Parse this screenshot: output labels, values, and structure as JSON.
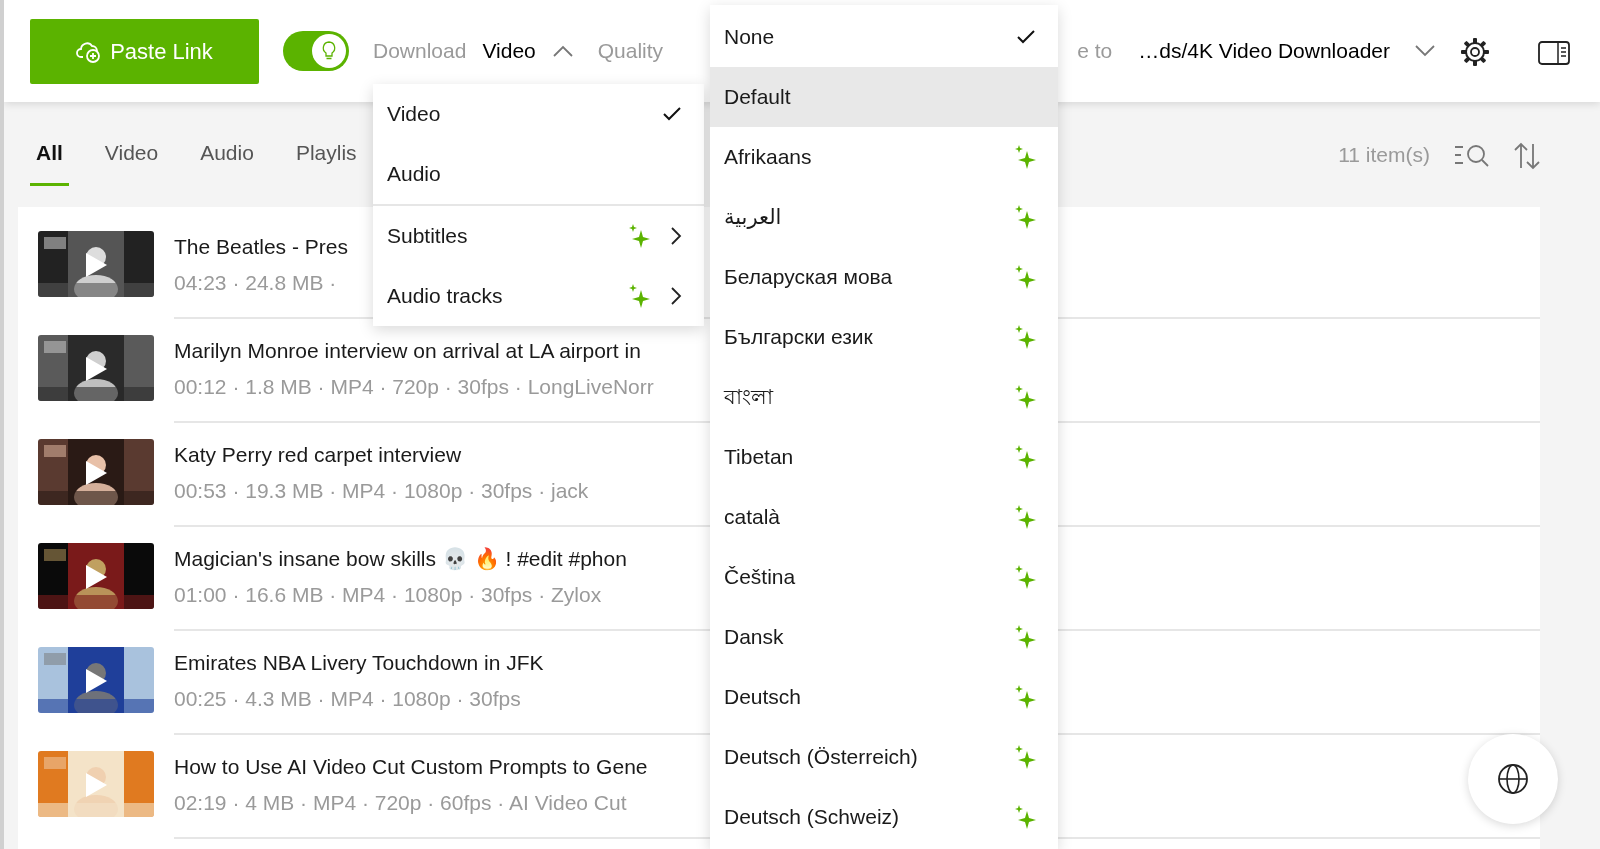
{
  "toolbar": {
    "paste_button": "Paste Link",
    "smart_mode": {
      "on": true
    },
    "download_label": "Download",
    "download_value": "Video",
    "download_open": true,
    "quality_label": "Quality",
    "save_label": "e to",
    "save_path": "…ds/4K Video Downloader"
  },
  "tabs": [
    {
      "label": "All",
      "selected": true
    },
    {
      "label": "Video",
      "selected": false
    },
    {
      "label": "Audio",
      "selected": false
    },
    {
      "label": "Playlis",
      "selected": false
    }
  ],
  "item_count": "11 item(s)",
  "items": [
    {
      "title": "The Beatles - Pres",
      "meta": "04:23 · 24.8 MB ·"
    },
    {
      "title": "Marilyn Monroe interview on arrival at LA airport in",
      "meta": "00:12 · 1.8 MB · MP4 · 720p · 30fps · LongLiveNorr"
    },
    {
      "title": "Katy Perry red carpet interview",
      "meta": "00:53 · 19.3 MB · MP4 · 1080p · 30fps · jack"
    },
    {
      "title": "Magician's insane bow skills 💀 🔥 !  #edit #phon",
      "meta": "01:00 · 16.6 MB · MP4 · 1080p · 30fps · Zylox"
    },
    {
      "title": "Emirates NBA Livery Touchdown in JFK",
      "meta": "00:25 · 4.3 MB · MP4 · 1080p · 30fps"
    },
    {
      "title": "How to Use AI Video Cut Custom Prompts to Gene",
      "meta": "02:19 · 4 MB · MP4 · 720p · 60fps · AI Video Cut"
    }
  ],
  "download_menu": [
    {
      "label": "Video",
      "kind": "option",
      "checked": true
    },
    {
      "label": "Audio",
      "kind": "option",
      "checked": false
    },
    {
      "label": "Subtitles",
      "kind": "submenu",
      "ai": true
    },
    {
      "label": "Audio tracks",
      "kind": "submenu",
      "ai": true
    }
  ],
  "subtitles_menu": [
    {
      "label": "None",
      "checked": true,
      "highlighted": false,
      "ai": false
    },
    {
      "label": "Default",
      "checked": false,
      "highlighted": true,
      "ai": false
    },
    {
      "label": "Afrikaans",
      "checked": false,
      "highlighted": false,
      "ai": true
    },
    {
      "label": "العربية",
      "checked": false,
      "highlighted": false,
      "ai": true
    },
    {
      "label": "Беларуская мова",
      "checked": false,
      "highlighted": false,
      "ai": true
    },
    {
      "label": "Български език",
      "checked": false,
      "highlighted": false,
      "ai": true
    },
    {
      "label": "বাংলা",
      "checked": false,
      "highlighted": false,
      "ai": true
    },
    {
      "label": "Tibetan",
      "checked": false,
      "highlighted": false,
      "ai": true
    },
    {
      "label": "català",
      "checked": false,
      "highlighted": false,
      "ai": true
    },
    {
      "label": "Čeština",
      "checked": false,
      "highlighted": false,
      "ai": true
    },
    {
      "label": "Dansk",
      "checked": false,
      "highlighted": false,
      "ai": true
    },
    {
      "label": "Deutsch",
      "checked": false,
      "highlighted": false,
      "ai": true
    },
    {
      "label": "Deutsch (Österreich)",
      "checked": false,
      "highlighted": false,
      "ai": true
    },
    {
      "label": "Deutsch (Schweiz)",
      "checked": false,
      "highlighted": false,
      "ai": true
    }
  ]
}
